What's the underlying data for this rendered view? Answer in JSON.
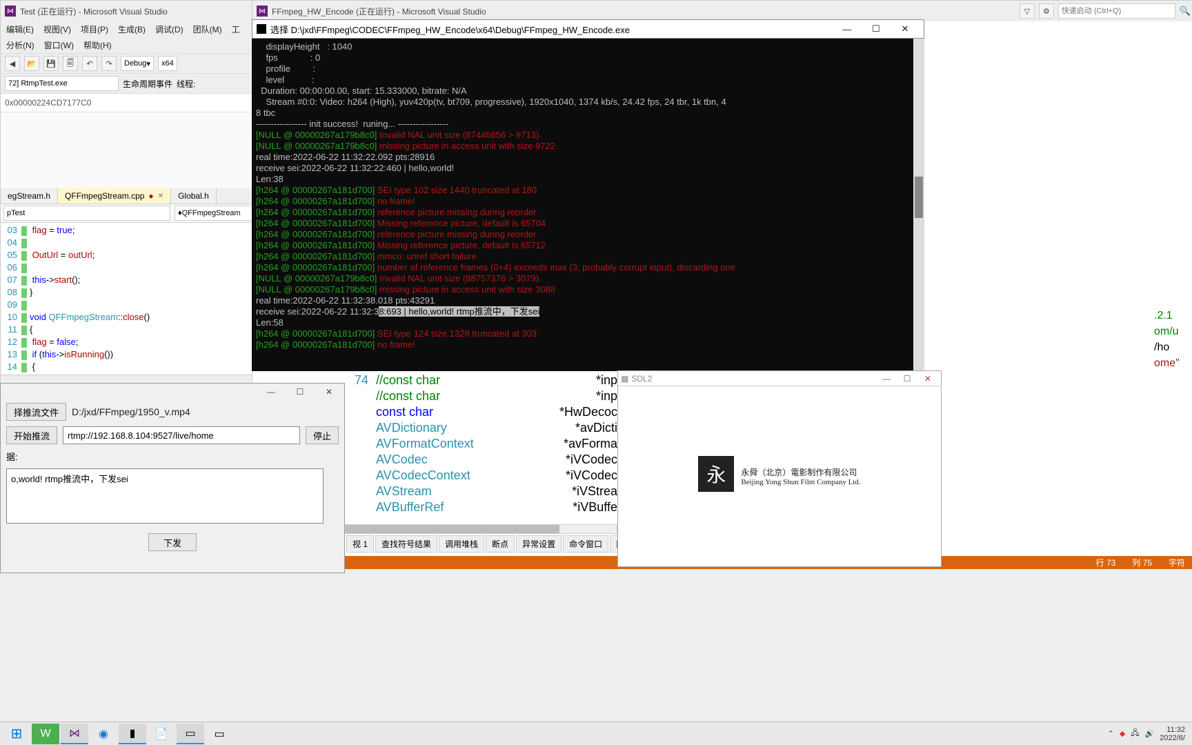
{
  "vs_left": {
    "title": "Test (正在运行) - Microsoft Visual Studio",
    "menu1": [
      "编辑(E)",
      "视图(V)",
      "项目(P)",
      "生成(B)",
      "调试(D)",
      "团队(M)",
      "工"
    ],
    "menu2": [
      "分析(N)",
      "窗口(W)",
      "帮助(H)"
    ],
    "config": "Debug",
    "platform": "x64",
    "proc": "72] RtmpTest.exe",
    "lifecycle": "生命周期事件",
    "thread": "线程:",
    "watch": "0x00000224CD7177C0",
    "tabs": [
      "egStream.h",
      "QFFmpegStream.cpp",
      "Global.h"
    ],
    "scope_left": "pTest",
    "scope_right": "QFFmpegStream",
    "code_lines": [
      {
        "n": "03",
        "t": "    flag = true;"
      },
      {
        "n": "04",
        "t": ""
      },
      {
        "n": "05",
        "t": "    OutUrl = outUrl;"
      },
      {
        "n": "06",
        "t": ""
      },
      {
        "n": "07",
        "t": "    this->start();"
      },
      {
        "n": "08",
        "t": "}"
      },
      {
        "n": "09",
        "t": ""
      },
      {
        "n": "10",
        "t": "void QFFmpegStream::close()"
      },
      {
        "n": "11",
        "t": "{"
      },
      {
        "n": "12",
        "t": "    flag = false;"
      },
      {
        "n": "13",
        "t": "    if (this->isRunning())"
      },
      {
        "n": "14",
        "t": "    {"
      }
    ]
  },
  "vs_right": {
    "title": "FFmpeg_HW_Encode (正在运行) - Microsoft Visual Studio",
    "quick_ph": "快速启动 (Ctrl+Q)",
    "peek": [
      ".2.1",
      "om/u",
      "/ho",
      "ome\""
    ],
    "code": [
      {
        "n": "74",
        "c": "//const char",
        "p": "*inp",
        "cls": "cmt"
      },
      {
        "n": "",
        "c": "//const char",
        "p": "*inp",
        "cls": "cmt"
      },
      {
        "n": "",
        "c": "const char",
        "p": "*HwDecoc",
        "cls": "kw2"
      },
      {
        "n": "",
        "c": "AVDictionary",
        "p": "*avDicti",
        "cls": "ty2"
      },
      {
        "n": "",
        "c": "AVFormatContext",
        "p": "*avForma",
        "cls": "ty2"
      },
      {
        "n": "",
        "c": "AVCodec",
        "p": "*iVCodec",
        "cls": "ty2"
      },
      {
        "n": "",
        "c": "AVCodecContext",
        "p": "*iVCodec",
        "cls": "ty2"
      },
      {
        "n": "",
        "c": "AVStream",
        "p": "*iVStrea",
        "cls": "ty2"
      },
      {
        "n": "",
        "c": "AVBufferRef",
        "p": "*iVBuffe",
        "cls": "ty2"
      }
    ],
    "bottom_tabs": [
      "视 1",
      "查找符号结果",
      "调用堆栈",
      "断点",
      "异常设置",
      "命令窗口",
      "即时窗口"
    ],
    "status": {
      "row": "行 73",
      "col": "列 75",
      "ch": "字符"
    }
  },
  "console": {
    "title": "选择 D:\\jxd\\FFmpeg\\CODEC\\FFmpeg_HW_Encode\\x64\\Debug\\FFmpeg_HW_Encode.exe",
    "lines": [
      {
        "t": "    displayHeight   : 1040",
        "c": "wh"
      },
      {
        "t": "    fps             : 0",
        "c": "wh"
      },
      {
        "t": "    profile         :",
        "c": "wh"
      },
      {
        "t": "    level           :",
        "c": "wh"
      },
      {
        "t": "  Duration: 00:00:00.00, start: 15.333000, bitrate: N/A",
        "c": "wh"
      },
      {
        "t": "    Stream #0:0: Video: h264 (High), yuv420p(tv, bt709, progressive), 1920x1040, 1374 kb/s, 24.42 fps, 24 tbr, 1k tbn, 4",
        "c": "wh"
      },
      {
        "t": "8 tbc",
        "c": "wh"
      },
      {
        "t": "",
        "c": "wh"
      },
      {
        "t": "----------------- init success!  runing... -----------------",
        "c": "wh"
      },
      {
        "seg": [
          {
            "t": "[NULL @ 00000267a179b8c0] ",
            "c": "gr"
          },
          {
            "t": "Invalid NAL unit size (87446656 > 9713).",
            "c": "rd"
          }
        ]
      },
      {
        "seg": [
          {
            "t": "[NULL @ 00000267a179b8c0] ",
            "c": "gr"
          },
          {
            "t": "missing picture in access unit with size 9722",
            "c": "rd"
          }
        ]
      },
      {
        "t": "real time:2022-06-22 11:32:22.092 pts:28916",
        "c": "wh"
      },
      {
        "t": "receive sei:2022-06-22 11:32:22:460 | hello,world!",
        "c": "wh"
      },
      {
        "t": "Len:38",
        "c": "wh"
      },
      {
        "seg": [
          {
            "t": "[h264 @ 00000267a181d700] ",
            "c": "gr"
          },
          {
            "t": "SEI type 102 size 1440 truncated at 180",
            "c": "rd"
          }
        ]
      },
      {
        "seg": [
          {
            "t": "[h264 @ 00000267a181d700] ",
            "c": "gr"
          },
          {
            "t": "no frame!",
            "c": "rd"
          }
        ]
      },
      {
        "seg": [
          {
            "t": "[h264 @ 00000267a181d700] ",
            "c": "gr"
          },
          {
            "t": "reference picture missing during reorder",
            "c": "rd"
          }
        ]
      },
      {
        "seg": [
          {
            "t": "[h264 @ 00000267a181d700] ",
            "c": "gr"
          },
          {
            "t": "Missing reference picture, default is 65704",
            "c": "rd"
          }
        ]
      },
      {
        "seg": [
          {
            "t": "[h264 @ 00000267a181d700] ",
            "c": "gr"
          },
          {
            "t": "reference picture missing during reorder",
            "c": "rd"
          }
        ]
      },
      {
        "seg": [
          {
            "t": "[h264 @ 00000267a181d700] ",
            "c": "gr"
          },
          {
            "t": "Missing reference picture, default is 65712",
            "c": "rd"
          }
        ]
      },
      {
        "seg": [
          {
            "t": "[h264 @ 00000267a181d700] ",
            "c": "gr"
          },
          {
            "t": "mmco: unref short failure",
            "c": "rd"
          }
        ]
      },
      {
        "seg": [
          {
            "t": "[h264 @ 00000267a181d700] ",
            "c": "gr"
          },
          {
            "t": "number of reference frames (0+4) exceeds max (3; probably corrupt input), discarding one",
            "c": "rd"
          }
        ]
      },
      {
        "seg": [
          {
            "t": "[NULL @ 00000267a179b8c0] ",
            "c": "gr"
          },
          {
            "t": "Invalid NAL unit size (88757376 > 3079).",
            "c": "rd"
          }
        ]
      },
      {
        "seg": [
          {
            "t": "[NULL @ 00000267a179b8c0] ",
            "c": "gr"
          },
          {
            "t": "missing picture in access unit with size 3088",
            "c": "rd"
          }
        ]
      },
      {
        "t": "real time:2022-06-22 11:32:38.018 pts:43291",
        "c": "wh"
      },
      {
        "seg": [
          {
            "t": "receive sei:2022-06-22 11:32:3",
            "c": "wh"
          },
          {
            "t": "8:693 | hello,world! rtmp推流中，下发sei",
            "c": "sel"
          }
        ]
      },
      {
        "t": "Len:58",
        "c": "wh"
      },
      {
        "seg": [
          {
            "t": "[h264 @ 00000267a181d700] ",
            "c": "gr"
          },
          {
            "t": "SEI type 124 size 1328 truncated at 303",
            "c": "rd"
          }
        ]
      },
      {
        "seg": [
          {
            "t": "[h264 @ 00000267a181d700] ",
            "c": "gr"
          },
          {
            "t": "no frame!",
            "c": "rd"
          }
        ]
      }
    ]
  },
  "form": {
    "choose_btn": "择推流文件",
    "path": "D:/jxd/FFmpeg/1950_v.mp4",
    "start_btn": "开始推流",
    "url": "rtmp://192.168.8.104:9527/live/home",
    "stop_btn": "停止",
    "label_msg": "据:",
    "msg": "o,world! rtmp推流中，下发sei",
    "send_btn": "下发"
  },
  "sdl": {
    "title": "SDL2",
    "logo_char": "永",
    "line_cn": "永舜（北京）電影制作有限公司",
    "line_en": "Beijing Yong Shun Film Company Ltd."
  },
  "taskbar": {
    "time": "11:32",
    "date": "2022/6/"
  }
}
